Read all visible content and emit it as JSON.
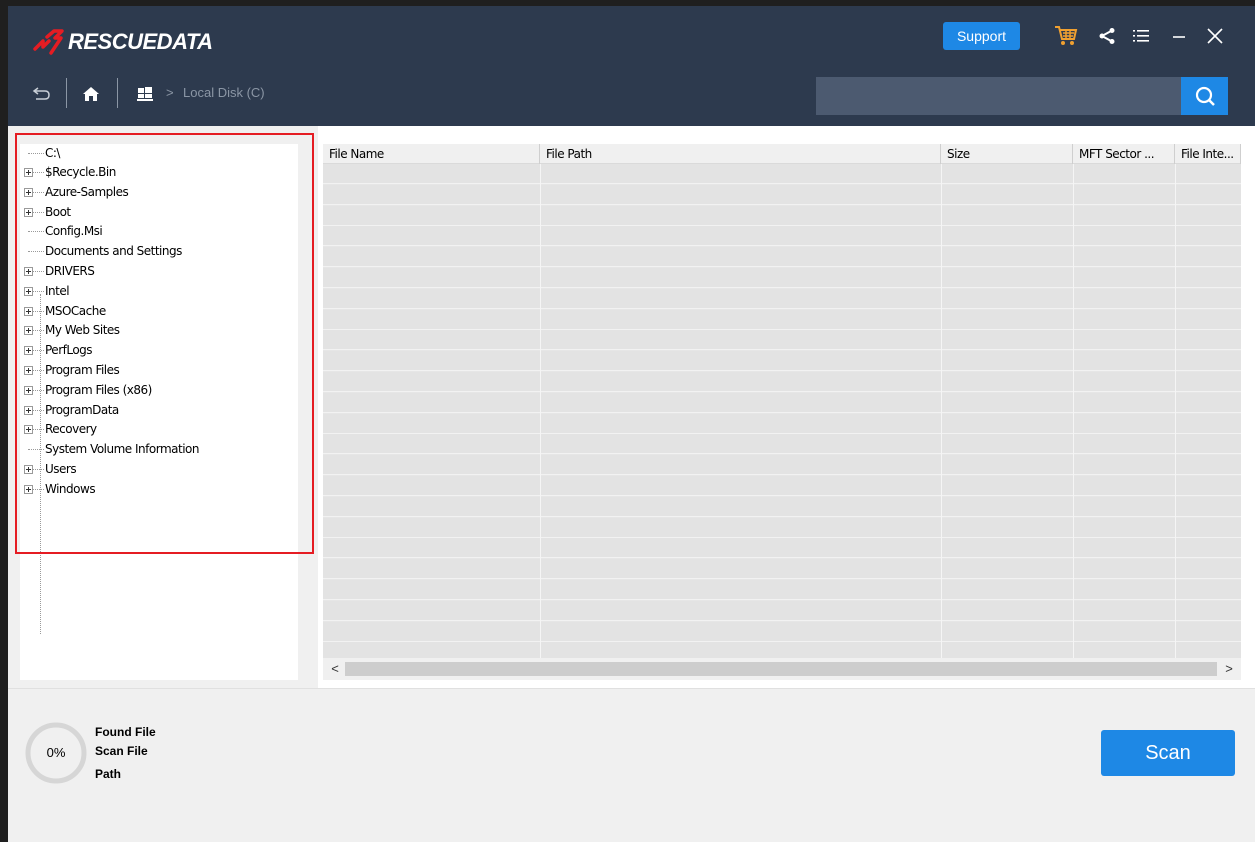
{
  "app": {
    "name": "RESCUEDATA",
    "accent": "#1e88e5",
    "header_bg": "#2d3a4e",
    "logo_color": "#e51c23"
  },
  "header": {
    "support_label": "Support",
    "icons": [
      "cart-icon",
      "share-icon",
      "menu-icon",
      "minimize-icon",
      "close-icon"
    ]
  },
  "nav": {
    "separator": ">",
    "breadcrumb": "Local Disk (C)",
    "search_placeholder": "",
    "icons": [
      "back-icon",
      "home-icon",
      "windows-drive-icon",
      "search-icon"
    ]
  },
  "tree": {
    "root": "C:\\",
    "items": [
      {
        "label": "$Recycle.Bin",
        "expandable": true
      },
      {
        "label": "Azure-Samples",
        "expandable": true
      },
      {
        "label": "Boot",
        "expandable": true
      },
      {
        "label": "Config.Msi",
        "expandable": false
      },
      {
        "label": "Documents and Settings",
        "expandable": false
      },
      {
        "label": "DRIVERS",
        "expandable": true
      },
      {
        "label": "Intel",
        "expandable": true
      },
      {
        "label": "MSOCache",
        "expandable": true
      },
      {
        "label": "My Web Sites",
        "expandable": true
      },
      {
        "label": "PerfLogs",
        "expandable": true
      },
      {
        "label": "Program Files",
        "expandable": true
      },
      {
        "label": "Program Files (x86)",
        "expandable": true
      },
      {
        "label": "ProgramData",
        "expandable": true
      },
      {
        "label": "Recovery",
        "expandable": true
      },
      {
        "label": "System Volume Information",
        "expandable": false
      },
      {
        "label": "Users",
        "expandable": true
      },
      {
        "label": "Windows",
        "expandable": true
      }
    ]
  },
  "table": {
    "columns": [
      "File Name",
      "File Path",
      "Size",
      "MFT Sector ...",
      "File Inte..."
    ],
    "rows": []
  },
  "scrollbar": {
    "left_arrow": "<",
    "right_arrow": ">"
  },
  "footer": {
    "progress": "0%",
    "progress_value": 0,
    "found_file_label": "Found File",
    "scan_file_label": "Scan File",
    "path_label": "Path",
    "scan_button": "Scan"
  }
}
